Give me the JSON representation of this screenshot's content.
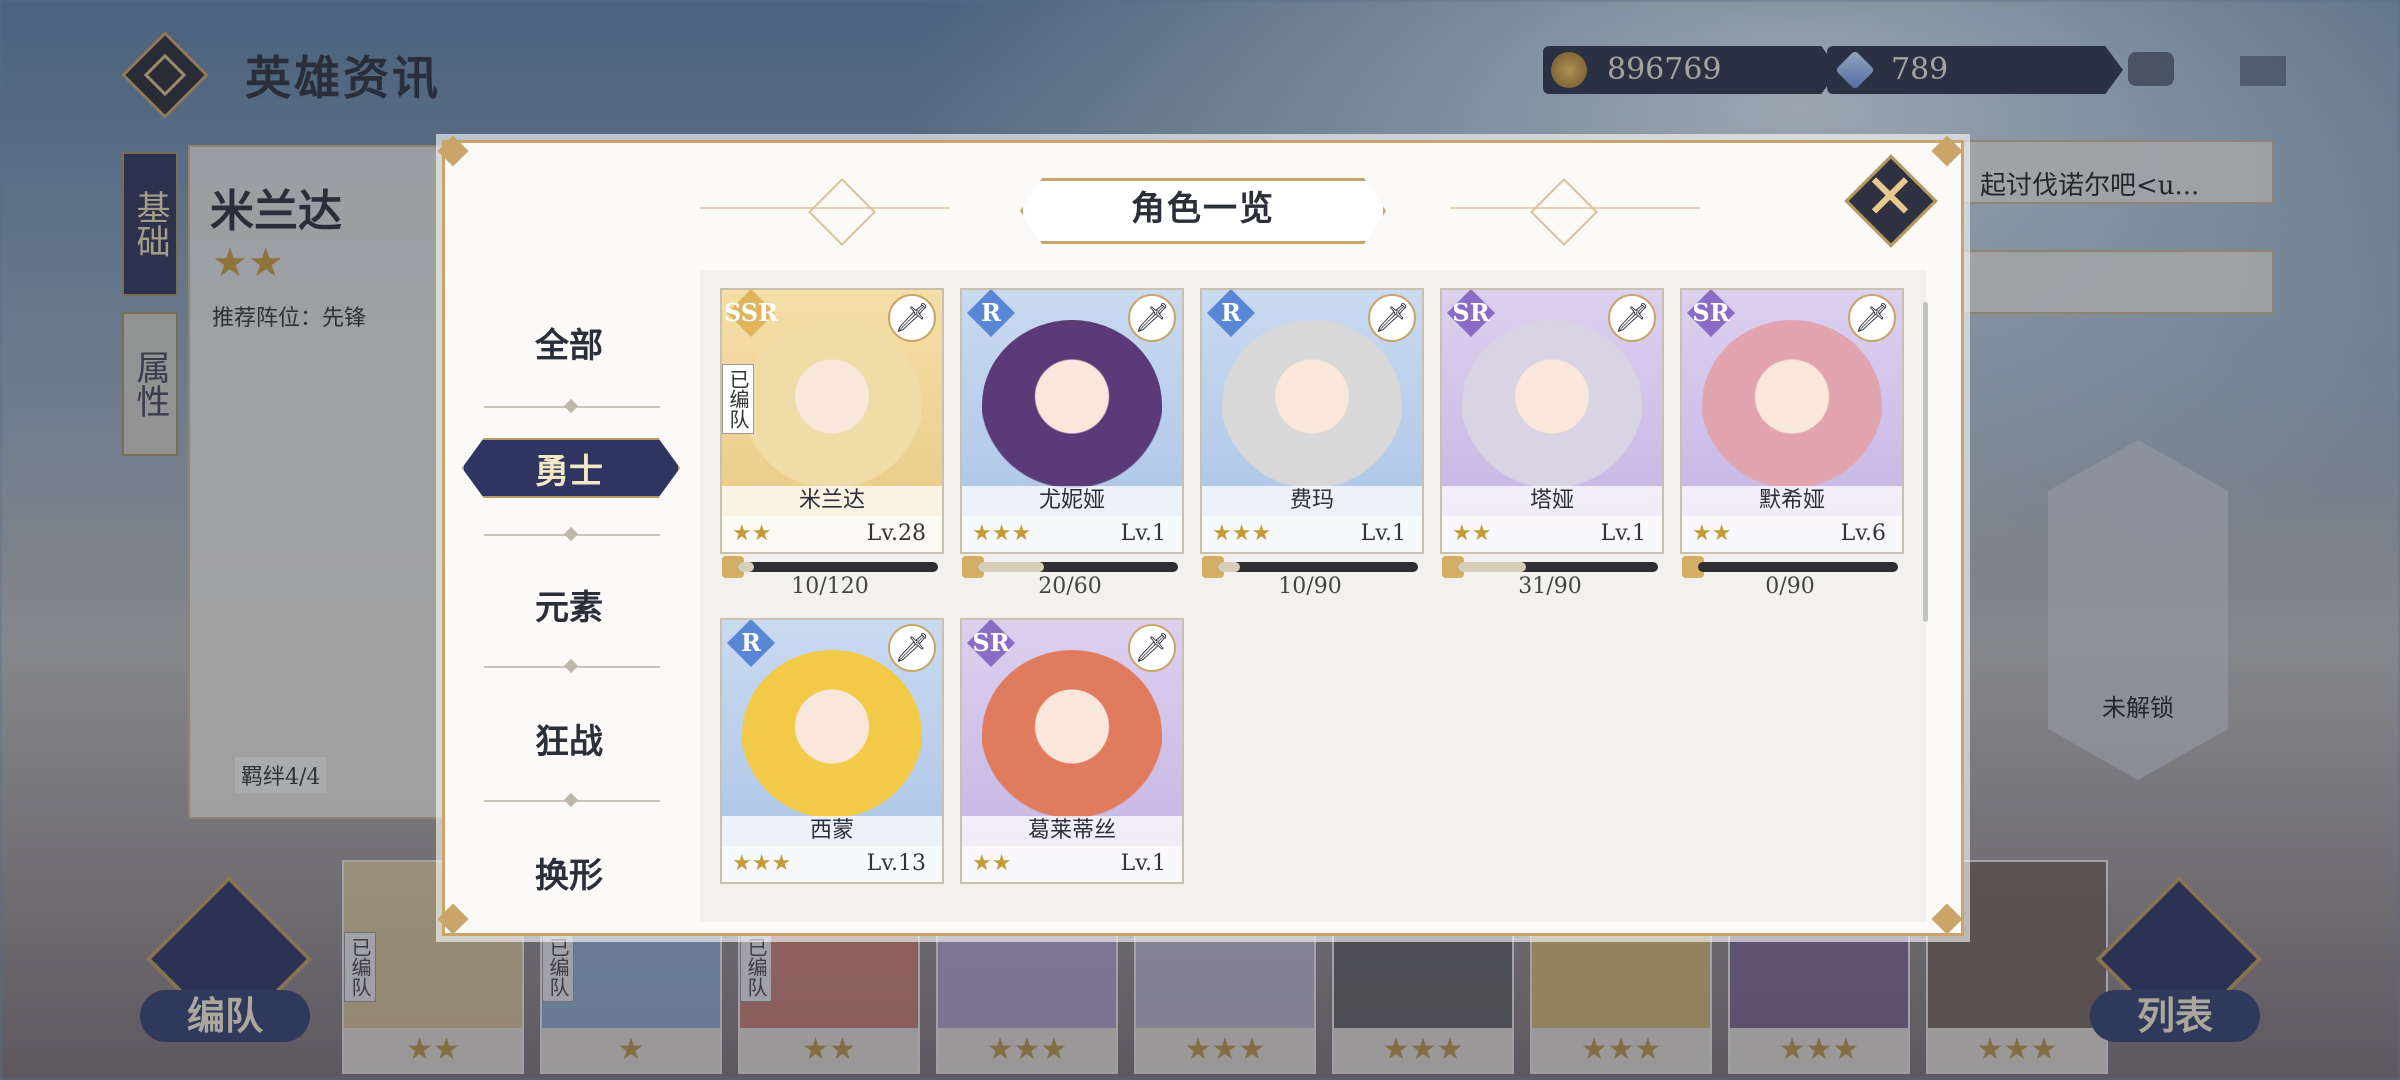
{
  "header": {
    "title": "英雄资讯",
    "gold": "896769",
    "gems": "789"
  },
  "background": {
    "hero_name": "米兰达",
    "hero_stars": "★★",
    "recommend": "推荐阵位：先锋",
    "tab_basic": "基础",
    "tab_attr": "属性",
    "bond": "羁绊4/4",
    "class_label": "勇士",
    "team_button": "编队",
    "list_button": "列表",
    "locked": "未解锁",
    "right_text": "起讨伐诺尔吧<u...",
    "strip_stars": [
      "★★",
      "★",
      "★★",
      "★★★",
      "★★★",
      "★★★",
      "★★★",
      "★★★",
      "★★★"
    ],
    "strip_tags": [
      "已编队",
      "已编队",
      "已编队"
    ]
  },
  "modal": {
    "title": "角色一览",
    "close_icon": "close-icon",
    "categories": [
      "全部",
      "勇士",
      "元素",
      "狂战",
      "换形"
    ],
    "active_category": "勇士"
  },
  "cards": [
    {
      "name": "米兰达",
      "rarity": "SSR",
      "stars": "★★",
      "level": "Lv.28",
      "progress": "10/120",
      "fill": 0.08,
      "in_team": "已编队",
      "bg": "gold",
      "class_icon": "sword-icon"
    },
    {
      "name": "尤妮娅",
      "rarity": "R",
      "stars": "★★★",
      "level": "Lv.1",
      "progress": "20/60",
      "fill": 0.33,
      "bg": "blue",
      "class_icon": "sword-icon"
    },
    {
      "name": "费玛",
      "rarity": "R",
      "stars": "★★★",
      "level": "Lv.1",
      "progress": "10/90",
      "fill": 0.11,
      "bg": "blue",
      "class_icon": "sword-icon"
    },
    {
      "name": "塔娅",
      "rarity": "SR",
      "stars": "★★",
      "level": "Lv.1",
      "progress": "31/90",
      "fill": 0.34,
      "bg": "purple",
      "class_icon": "sword-icon"
    },
    {
      "name": "默希娅",
      "rarity": "SR",
      "stars": "★★",
      "level": "Lv.6",
      "progress": "0/90",
      "fill": 0.0,
      "bg": "purple",
      "class_icon": "sword-icon"
    },
    {
      "name": "西蒙",
      "rarity": "R",
      "stars": "★★★",
      "level": "Lv.13",
      "bg": "blue",
      "class_icon": "sword-icon"
    },
    {
      "name": "葛莱蒂丝",
      "rarity": "SR",
      "stars": "★★",
      "level": "Lv.1",
      "bg": "purple",
      "class_icon": "sword-icon"
    }
  ],
  "colors": {
    "gold_frame": "#c9a56a",
    "navy": "#2d3560",
    "ssr": "#e0b45a",
    "r": "#5a86d6",
    "sr": "#8a6cc4"
  }
}
